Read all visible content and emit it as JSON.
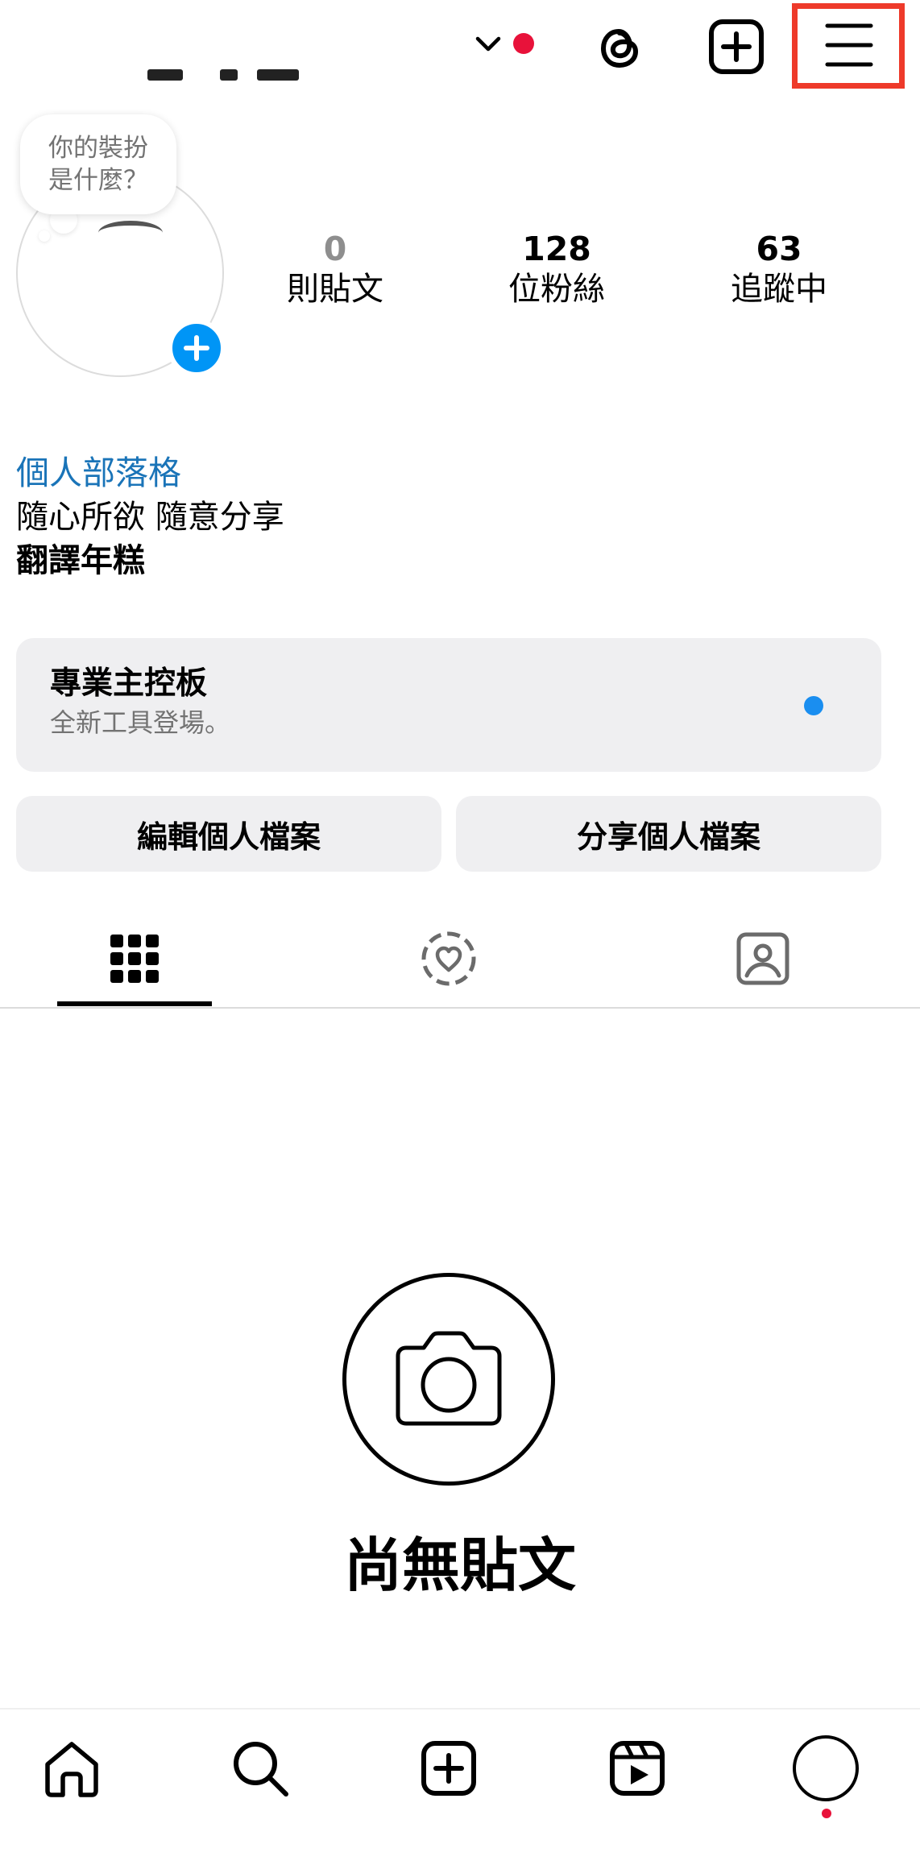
{
  "header": {
    "menu_highlight_color": "#ee3a2a",
    "notification_dot_color": "#e8123a"
  },
  "profile": {
    "note": {
      "line1": "你的裝扮",
      "line2": "是什麼？"
    },
    "stats": {
      "posts_count": "0",
      "posts_label": "則貼文",
      "followers_count": "128",
      "followers_label": "位粉絲",
      "following_count": "63",
      "following_label": "追蹤中"
    },
    "bio": {
      "category": "個人部落格",
      "text": "隨心所欲 隨意分享",
      "bold_text": "翻譯年糕"
    }
  },
  "dashboard": {
    "title": "專業主控板",
    "subtitle": "全新工具登場。",
    "dot_color": "#1a8ef0"
  },
  "buttons": {
    "edit_profile": "編輯個人檔案",
    "share_profile": "分享個人檔案"
  },
  "tabs": [
    {
      "icon": "grid-icon",
      "active": true
    },
    {
      "icon": "reels-heart-icon",
      "active": false
    },
    {
      "icon": "tagged-icon",
      "active": false
    }
  ],
  "empty_state": {
    "icon": "camera-icon",
    "title": "尚無貼文"
  },
  "bottom_nav": {
    "items": [
      "home-icon",
      "search-icon",
      "create-icon",
      "reels-icon",
      "profile-icon"
    ],
    "profile_dot_color": "#e8123a"
  },
  "colors": {
    "accent_blue": "#0095f6",
    "link_blue": "#1a74b8",
    "panel_gray": "#efeff1"
  }
}
